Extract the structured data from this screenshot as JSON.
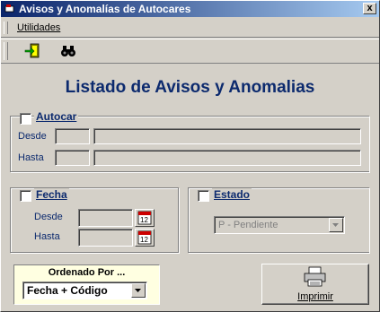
{
  "window": {
    "title": "Avisos y Anomalías de Autocares",
    "close_label": "x"
  },
  "menu": {
    "items": [
      {
        "label": "Utilidades"
      }
    ]
  },
  "toolbar": {
    "buttons": [
      {
        "icon": "exit-door-icon"
      },
      {
        "icon": "binoculars-icon"
      }
    ]
  },
  "main": {
    "heading": "Listado de Avisos y Anomalias"
  },
  "autocar": {
    "label": "Autocar",
    "checked": false,
    "desde_label": "Desde",
    "hasta_label": "Hasta"
  },
  "fecha": {
    "label": "Fecha",
    "checked": false,
    "desde_label": "Desde",
    "hasta_label": "Hasta"
  },
  "estado": {
    "label": "Estado",
    "checked": false,
    "selected": "P - Pendiente"
  },
  "orden": {
    "title": "Ordenado Por ...",
    "selected": "Fecha + Código"
  },
  "imprimir": {
    "label": "Imprimir"
  },
  "colors": {
    "title_start": "#0a246a",
    "title_end": "#a6caf0",
    "heading": "#0c2a6e",
    "face": "#d4d0c8",
    "tooltip_bg": "#ffffe1"
  }
}
